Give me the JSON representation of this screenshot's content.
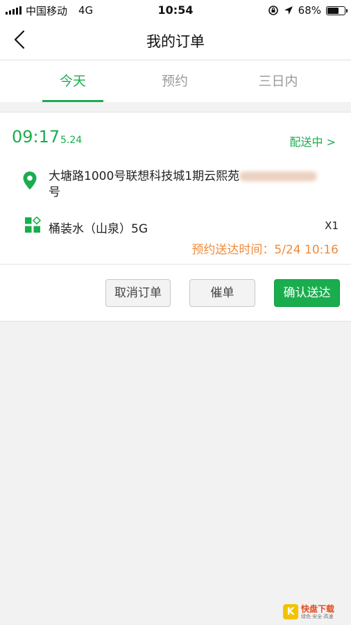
{
  "status_bar": {
    "carrier": "中国移动",
    "network": "4G",
    "time": "10:54",
    "battery": "68%",
    "battery_level": 0.68
  },
  "nav": {
    "title": "我的订单"
  },
  "tabs": [
    {
      "label": "今天",
      "active": true
    },
    {
      "label": "预约",
      "active": false
    },
    {
      "label": "三日内",
      "active": false
    }
  ],
  "order": {
    "time": "09:17",
    "date": "5.24",
    "status": "配送中 >",
    "address_line1": "大塘路1000号联想科技城1期云熙苑",
    "address_line2": "号",
    "product_name": "桶装水（山泉）5G",
    "quantity": "X1",
    "reserve_time": "预约送达时间：5/24 10:16",
    "buttons": {
      "cancel": "取消订单",
      "urge": "催单",
      "confirm": "确认送达"
    }
  },
  "watermark": {
    "badge": "K",
    "title": "快盘下载",
    "subtitle": "绿色·安全·高速"
  },
  "colors": {
    "accent": "#1aad4e",
    "orange": "#f08a3a"
  }
}
